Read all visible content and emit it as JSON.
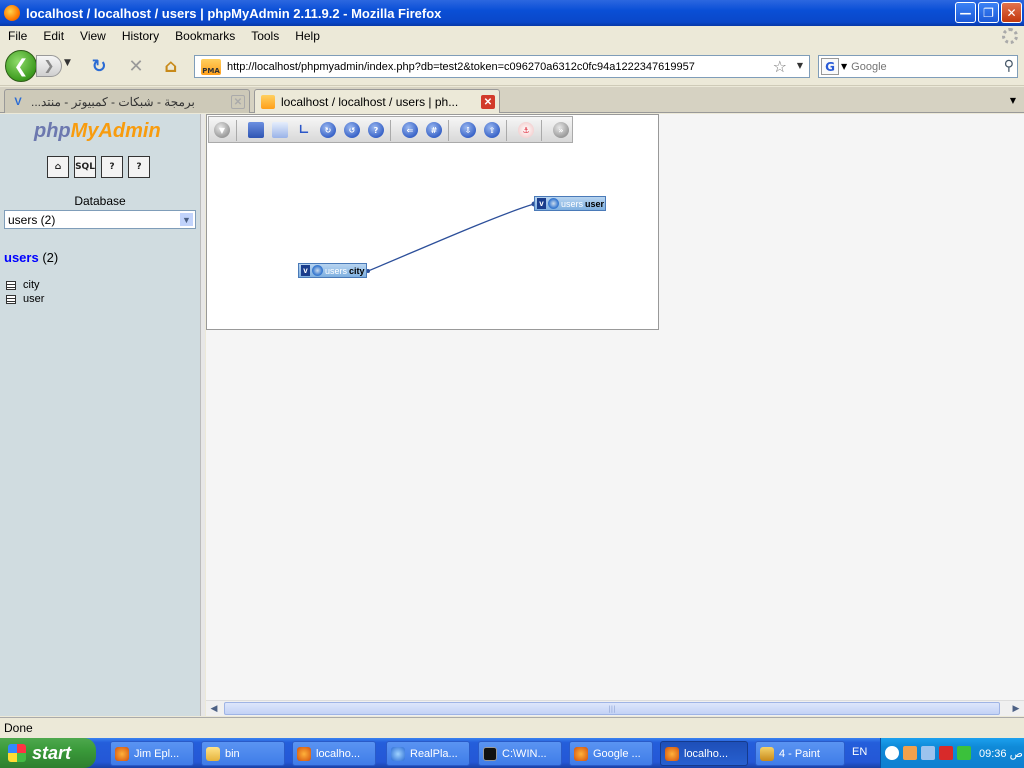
{
  "window": {
    "title": "localhost / localhost / users | phpMyAdmin 2.11.9.2 - Mozilla Firefox",
    "buttons": [
      "minimize",
      "maximize",
      "close"
    ]
  },
  "menu": [
    "File",
    "Edit",
    "View",
    "History",
    "Bookmarks",
    "Tools",
    "Help"
  ],
  "nav": {
    "url": "http://localhost/phpmyadmin/index.php?db=test2&token=c096270a6312c0fc94a1222347619957",
    "site_icon_text": "PMA",
    "search_placeholder": "Google"
  },
  "tabs": [
    {
      "label": "برمجة - شبكات - كمبيوتر - منتد...",
      "active": false
    },
    {
      "label": "localhost / localhost / users | ph...",
      "active": true
    }
  ],
  "sidebar": {
    "logo": {
      "php": "php",
      "my": "My",
      "admin": "Admin"
    },
    "quick_icons": [
      {
        "name": "home-icon",
        "glyph": "⌂"
      },
      {
        "name": "sql-icon",
        "glyph": "SQL"
      },
      {
        "name": "docs-icon",
        "glyph": "?"
      },
      {
        "name": "help-icon",
        "glyph": "?"
      }
    ],
    "database_label": "Database",
    "database_selected": "users (2)",
    "db_heading_name": "users",
    "db_heading_count": "(2)",
    "tables": [
      "city",
      "user"
    ]
  },
  "designer": {
    "tables": [
      {
        "db": "users",
        "name": "city"
      },
      {
        "db": "users",
        "name": "user"
      }
    ]
  },
  "status": "Done",
  "taskbar": {
    "start": "start",
    "buttons": [
      {
        "label": "Jim Epl...",
        "active": false
      },
      {
        "label": "bin",
        "active": false
      },
      {
        "label": "localho...",
        "active": false
      },
      {
        "label": "RealPla...",
        "active": false
      },
      {
        "label": "C:\\WIN...",
        "active": false
      },
      {
        "label": "Google ...",
        "active": false
      },
      {
        "label": "localho...",
        "active": true
      },
      {
        "label": "4 - Paint",
        "active": false
      }
    ],
    "language": "EN",
    "clock": "09:36 ص"
  }
}
